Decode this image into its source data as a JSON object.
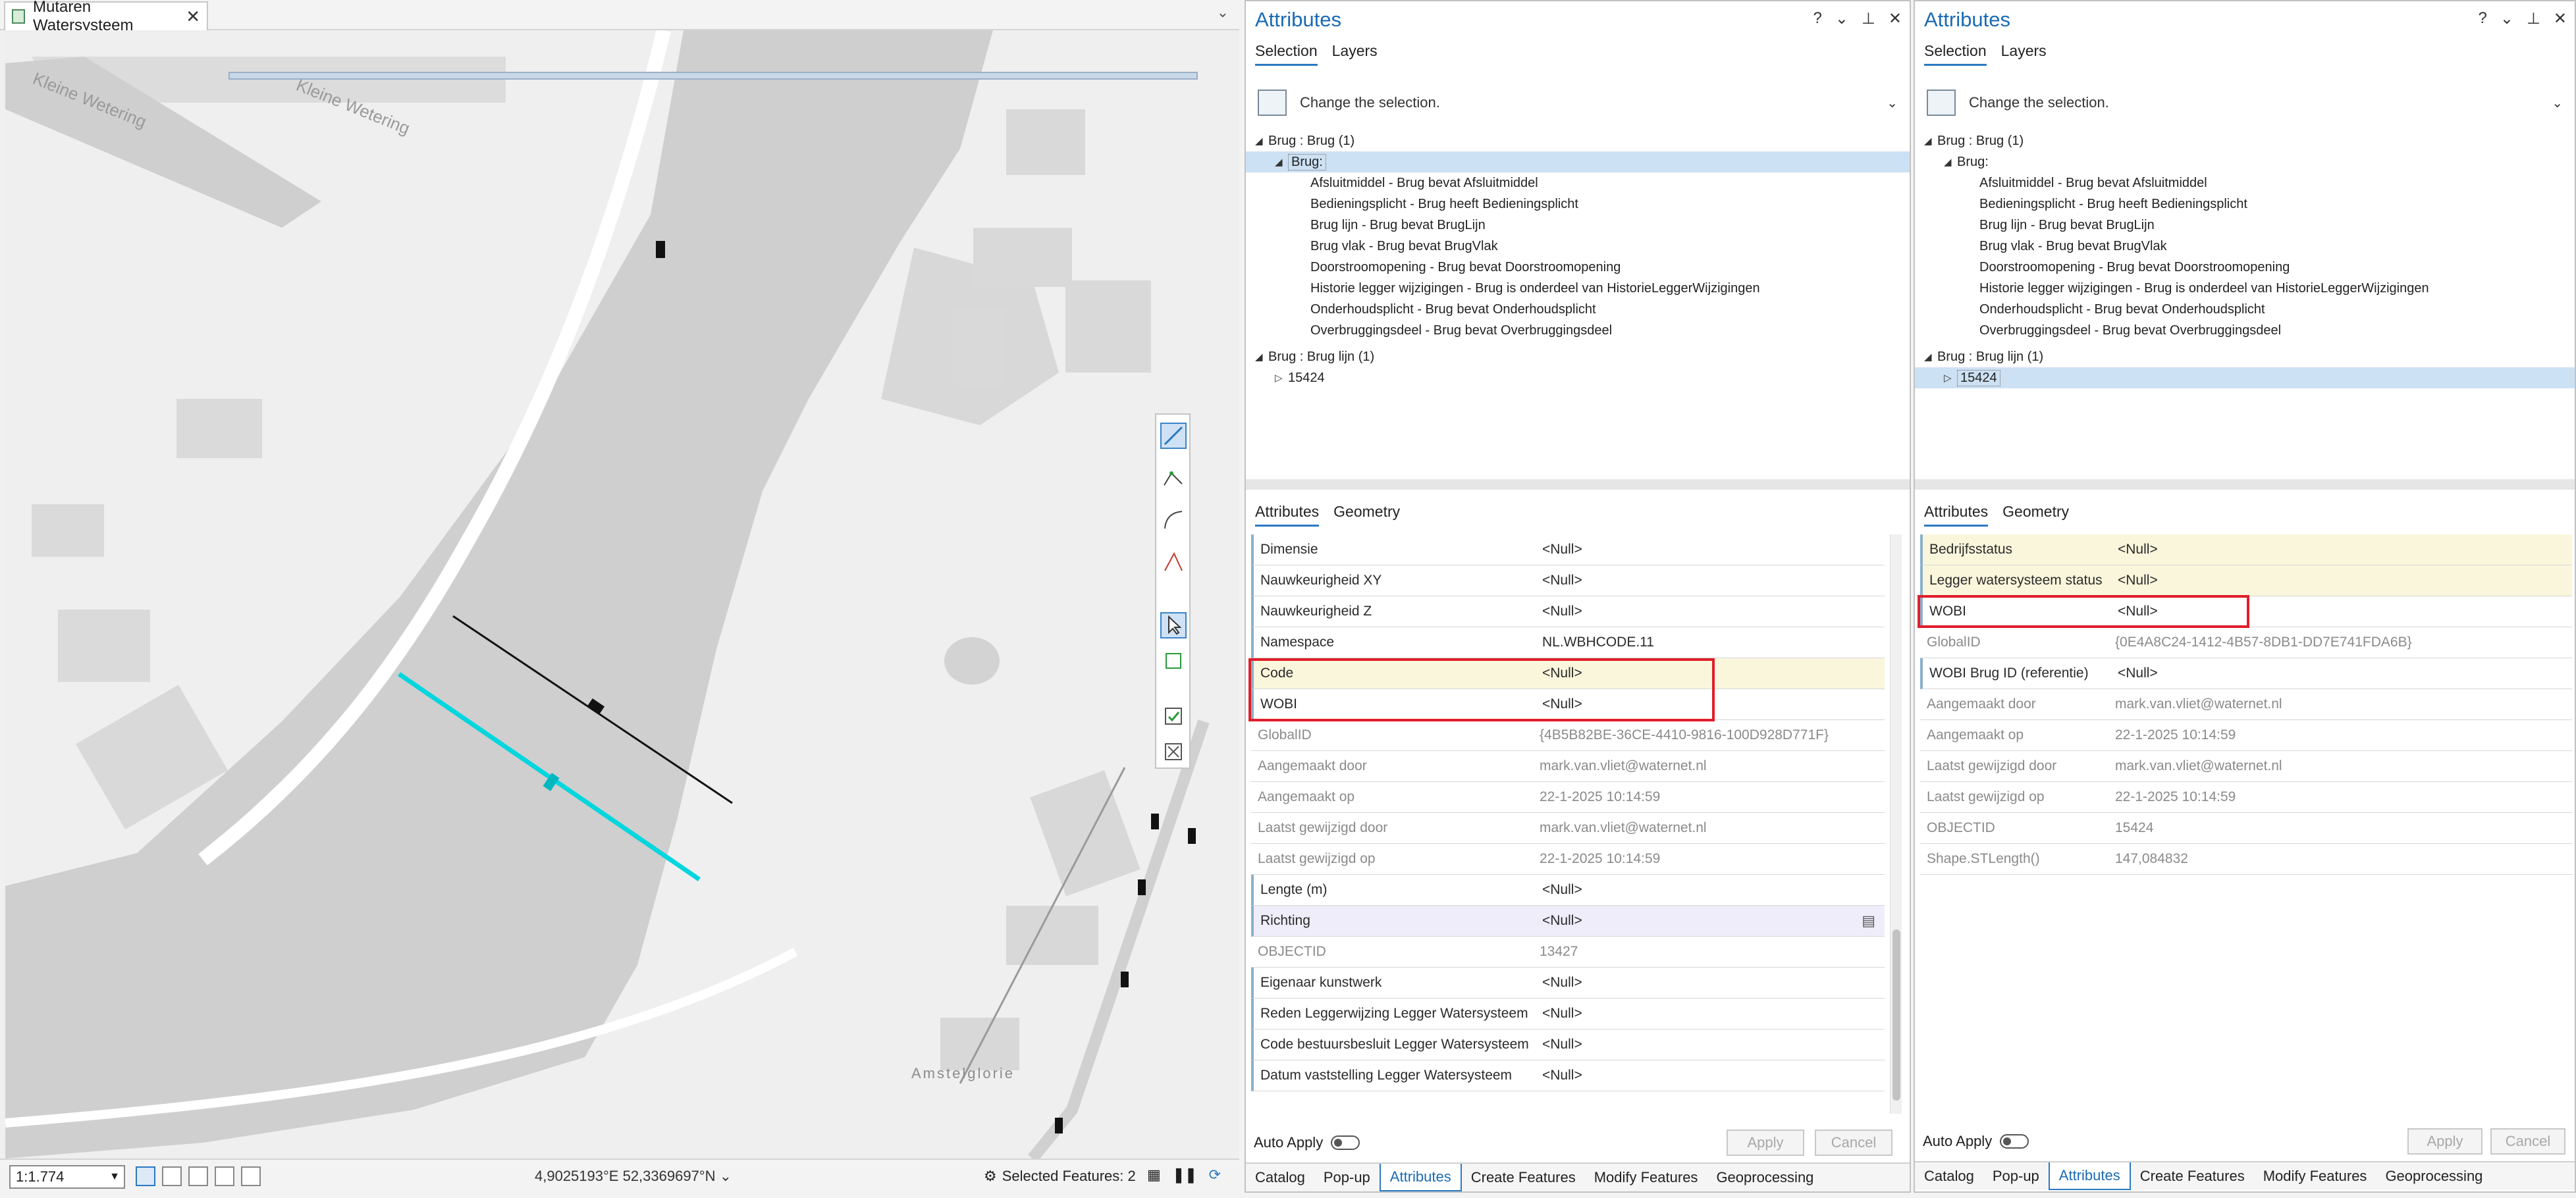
{
  "map": {
    "tab_title": "Mutaren Watersysteem",
    "labels": {
      "street_1": "Kleine Wetering",
      "street_2": "Kleine Wetering",
      "place": "Amstelglorie"
    },
    "scale": "1:1.774",
    "coordinates": "4,9025193°E 52,3369697°N",
    "selected_features": "Selected Features: 2"
  },
  "pane1": {
    "title": "Attributes",
    "tabs": [
      "Selection",
      "Layers"
    ],
    "change_selection": "Change the selection.",
    "tree": [
      {
        "label": "Brug : Brug (1)"
      },
      {
        "label": "Brug:"
      },
      {
        "label": "Afsluitmiddel - Brug bevat Afsluitmiddel"
      },
      {
        "label": "Bedieningsplicht - Brug heeft Bedieningsplicht"
      },
      {
        "label": "Brug lijn - Brug bevat BrugLijn"
      },
      {
        "label": "Brug vlak - Brug bevat BrugVlak"
      },
      {
        "label": "Doorstroomopening - Brug bevat Doorstroomopening"
      },
      {
        "label": "Historie legger wijzigingen - Brug is onderdeel van HistorieLeggerWijzigingen"
      },
      {
        "label": "Onderhoudsplicht - Brug bevat Onderhoudsplicht"
      },
      {
        "label": "Overbruggingsdeel - Brug bevat Overbruggingsdeel"
      },
      {
        "label": "Brug : Brug lijn (1)"
      },
      {
        "label": "15424"
      }
    ],
    "attr_tabs": [
      "Attributes",
      "Geometry"
    ],
    "rows": [
      {
        "name": "Dimensie",
        "value": "<Null>"
      },
      {
        "name": "Nauwkeurigheid XY",
        "value": "<Null>"
      },
      {
        "name": "Nauwkeurigheid Z",
        "value": "<Null>"
      },
      {
        "name": "Namespace",
        "value": "NL.WBHCODE.11"
      },
      {
        "name": "Code",
        "value": "<Null>"
      },
      {
        "name": "WOBI",
        "value": "<Null>"
      },
      {
        "name": "GlobalID",
        "value": "{4B5B82BE-36CE-4410-9816-100D928D771F}"
      },
      {
        "name": "Aangemaakt door",
        "value": "mark.van.vliet@waternet.nl"
      },
      {
        "name": "Aangemaakt op",
        "value": "22-1-2025 10:14:59"
      },
      {
        "name": "Laatst gewijzigd door",
        "value": "mark.van.vliet@waternet.nl"
      },
      {
        "name": "Laatst gewijzigd op",
        "value": "22-1-2025 10:14:59"
      },
      {
        "name": "Lengte (m)",
        "value": "<Null>"
      },
      {
        "name": "Richting",
        "value": "<Null>"
      },
      {
        "name": "OBJECTID",
        "value": "13427"
      },
      {
        "name": "Eigenaar kunstwerk",
        "value": "<Null>"
      },
      {
        "name": "Reden Leggerwijzing Legger Watersysteem",
        "value": "<Null>"
      },
      {
        "name": "Code bestuursbesluit Legger Watersysteem",
        "value": "<Null>"
      },
      {
        "name": "Datum vaststelling Legger Watersysteem",
        "value": "<Null>"
      }
    ],
    "auto_apply": "Auto Apply",
    "apply": "Apply",
    "cancel": "Cancel",
    "dock_tabs": [
      "Catalog",
      "Pop-up",
      "Attributes",
      "Create Features",
      "Modify Features",
      "Geoprocessing"
    ]
  },
  "pane2": {
    "title": "Attributes",
    "tabs": [
      "Selection",
      "Layers"
    ],
    "change_selection": "Change the selection.",
    "tree": [
      {
        "label": "Brug : Brug (1)"
      },
      {
        "label": "Brug:"
      },
      {
        "label": "Afsluitmiddel - Brug bevat Afsluitmiddel"
      },
      {
        "label": "Bedieningsplicht - Brug heeft Bedieningsplicht"
      },
      {
        "label": "Brug lijn - Brug bevat BrugLijn"
      },
      {
        "label": "Brug vlak - Brug bevat BrugVlak"
      },
      {
        "label": "Doorstroomopening - Brug bevat Doorstroomopening"
      },
      {
        "label": "Historie legger wijzigingen - Brug is onderdeel van HistorieLeggerWijzigingen"
      },
      {
        "label": "Onderhoudsplicht - Brug bevat Onderhoudsplicht"
      },
      {
        "label": "Overbruggingsdeel - Brug bevat Overbruggingsdeel"
      },
      {
        "label": "Brug : Brug lijn (1)"
      },
      {
        "label": "15424"
      }
    ],
    "attr_tabs": [
      "Attributes",
      "Geometry"
    ],
    "rows": [
      {
        "name": "Bedrijfsstatus",
        "value": "<Null>"
      },
      {
        "name": "Legger watersysteem status",
        "value": "<Null>"
      },
      {
        "name": "WOBI",
        "value": "<Null>"
      },
      {
        "name": "GlobalID",
        "value": "{0E4A8C24-1412-4B57-8DB1-DD7E741FDA6B}"
      },
      {
        "name": "WOBI Brug ID (referentie)",
        "value": "<Null>"
      },
      {
        "name": "Aangemaakt door",
        "value": "mark.van.vliet@waternet.nl"
      },
      {
        "name": "Aangemaakt op",
        "value": "22-1-2025 10:14:59"
      },
      {
        "name": "Laatst gewijzigd door",
        "value": "mark.van.vliet@waternet.nl"
      },
      {
        "name": "Laatst gewijzigd op",
        "value": "22-1-2025 10:14:59"
      },
      {
        "name": "OBJECTID",
        "value": "15424"
      },
      {
        "name": "Shape.STLength()",
        "value": "147,084832"
      }
    ],
    "auto_apply": "Auto Apply",
    "apply": "Apply",
    "cancel": "Cancel",
    "dock_tabs": [
      "Catalog",
      "Pop-up",
      "Attributes",
      "Create Features",
      "Modify Features",
      "Geoprocessing"
    ]
  },
  "colors": {
    "accent": "#2b79c2",
    "highlight_box": "#e01e2b",
    "selected_line": "#00d6de",
    "water": "#cfcfcf",
    "land": "#efefef"
  }
}
